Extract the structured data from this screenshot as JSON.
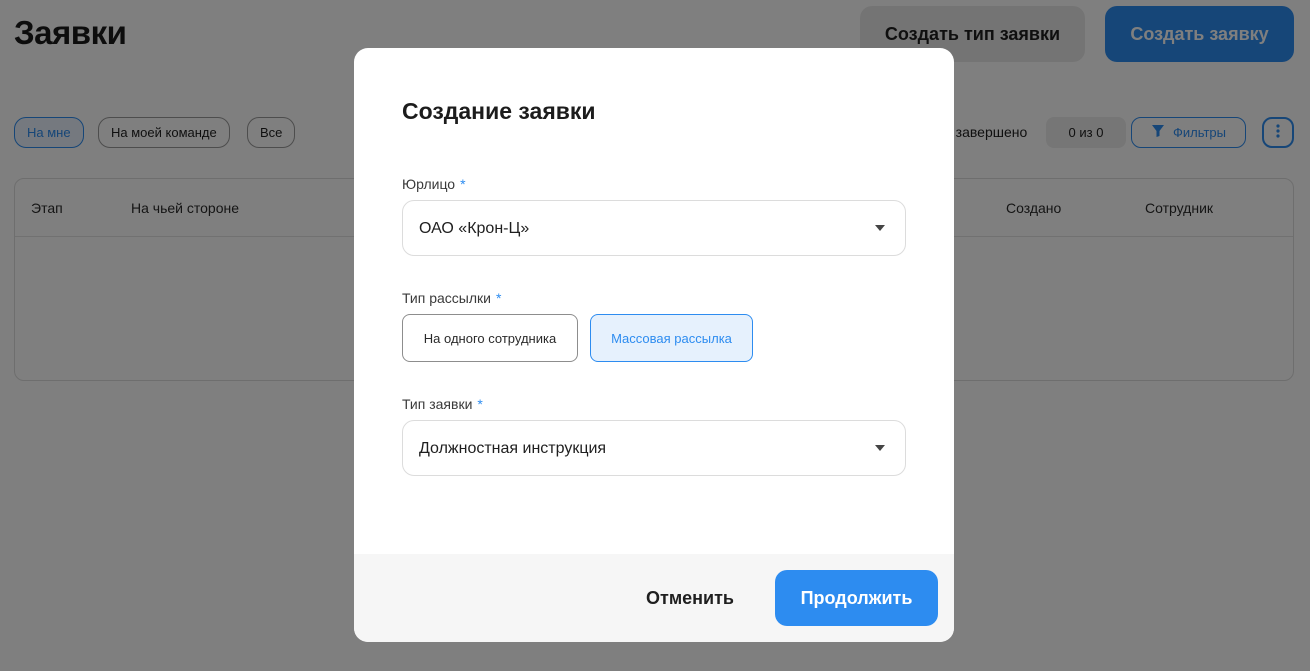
{
  "page": {
    "title": "Заявки",
    "create_type_button": "Создать тип заявки",
    "create_button": "Создать заявку",
    "chips": [
      "На мне",
      "На моей команде",
      "Все"
    ],
    "done_label": "о завершено",
    "done_count": "0 из 0",
    "filters_label": "Фильтры",
    "table_headers": [
      "Этап",
      "На чьей стороне",
      "Создано",
      "Сотрудник"
    ]
  },
  "modal": {
    "title": "Создание заявки",
    "legal_entity": {
      "label": "Юрлицо",
      "required_mark": "*",
      "value": "ОАО «Крон-Ц»"
    },
    "mailing_type": {
      "label": "Тип рассылки",
      "required_mark": "*",
      "options": [
        "На одного сотрудника",
        "Массовая рассылка"
      ],
      "selected": "Массовая рассылка"
    },
    "request_type": {
      "label": "Тип заявки",
      "required_mark": "*",
      "value": "Должностная инструкция"
    },
    "cancel_label": "Отменить",
    "continue_label": "Продолжить"
  },
  "colors": {
    "accent": "#2d8cf0",
    "overlay": "rgba(0,0,0,0.5)"
  }
}
